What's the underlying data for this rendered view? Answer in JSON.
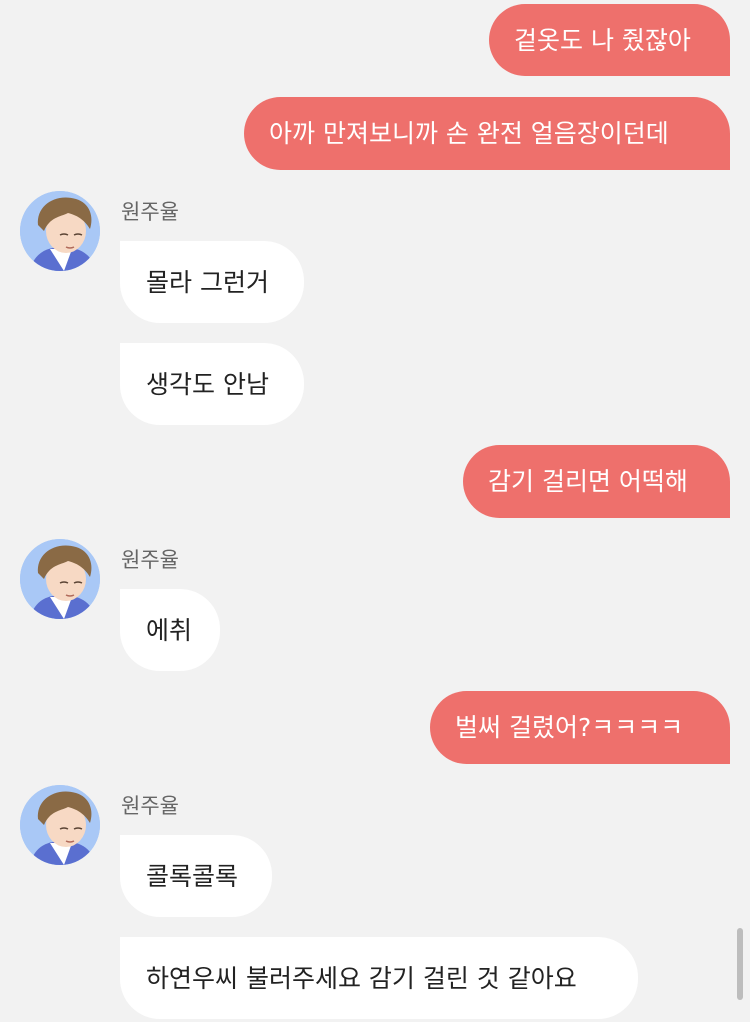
{
  "contact": {
    "name": "원주율"
  },
  "messages": [
    {
      "side": "out",
      "text": "겉옷도 나 줬잖아"
    },
    {
      "side": "out",
      "text": "아까 만져보니까 손 완전 얼음장이던데"
    },
    {
      "side": "in",
      "text": "몰라 그런거"
    },
    {
      "side": "in",
      "text": "생각도 안남"
    },
    {
      "side": "out",
      "text": "감기 걸리면 어떡해"
    },
    {
      "side": "in",
      "text": "에취"
    },
    {
      "side": "out",
      "text": "벌써 걸렸어?ㅋㅋㅋㅋ"
    },
    {
      "side": "in",
      "text": "콜록콜록"
    },
    {
      "side": "in",
      "text": "하연우씨 불러주세요 감기 걸린 것 같아요"
    }
  ]
}
